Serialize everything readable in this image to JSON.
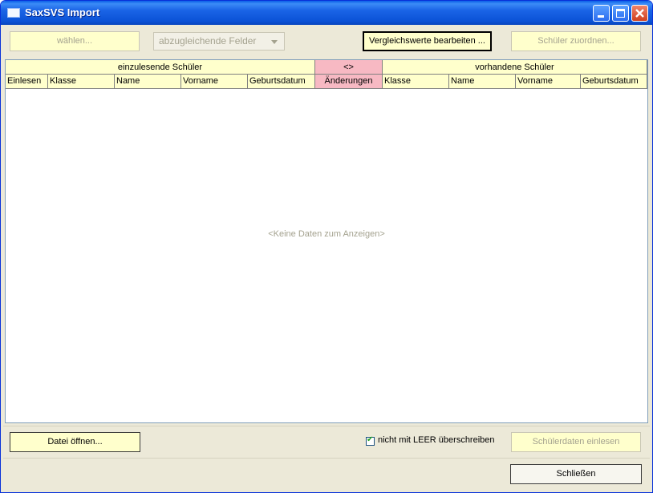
{
  "window": {
    "title": "SaxSVS Import"
  },
  "toolbar": {
    "select_button": "wählen...",
    "fields_combo": "abzugleichende Felder",
    "edit_compare_button": "Vergleichswerte bearbeiten ...",
    "assign_button": "Schüler zuordnen..."
  },
  "grid": {
    "group_left": "einzulesende Schüler",
    "group_middle": "<>",
    "group_right": "vorhandene Schüler",
    "columns": [
      "Einlesen",
      "Klasse",
      "Name",
      "Vorname",
      "Geburtsdatum",
      "Änderungen",
      "Klasse",
      "Name",
      "Vorname",
      "Geburtsdatum"
    ],
    "empty_text": "<Keine Daten zum Anzeigen>"
  },
  "bottom": {
    "open_file_button": "Datei öffnen...",
    "checkbox_label": "nicht mit LEER überschreiben",
    "checkbox_checked": true,
    "import_button": "Schülerdaten einlesen",
    "close_button": "Schließen"
  },
  "colors": {
    "button_bg": "#ffffcc",
    "changes_header": "#f7b9c3",
    "titlebar": "#0b52d6"
  }
}
